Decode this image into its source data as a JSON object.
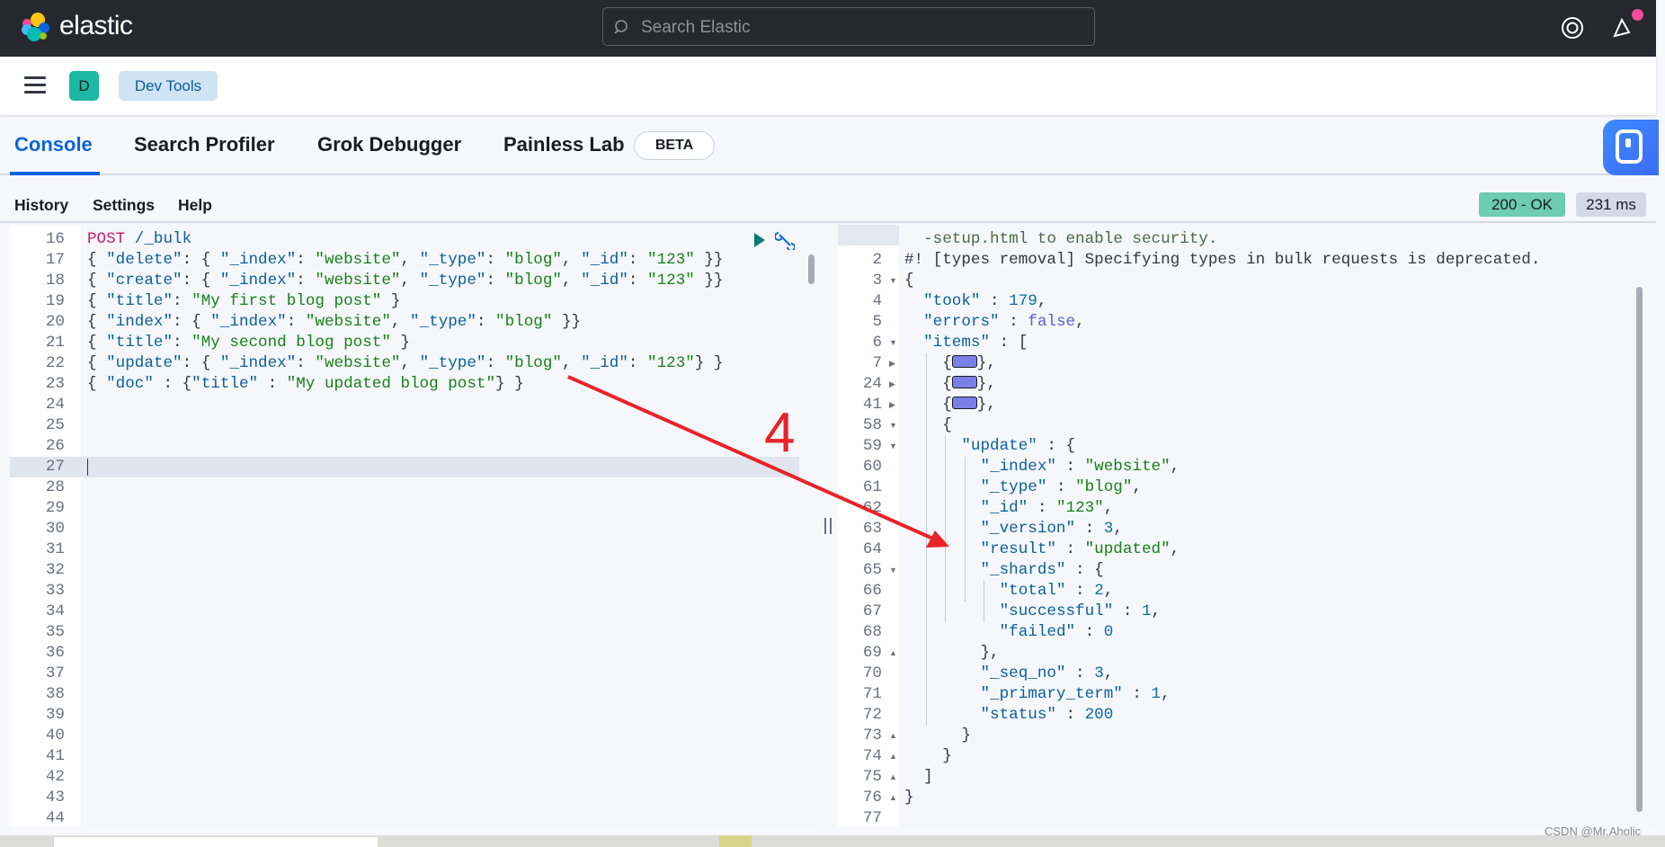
{
  "header": {
    "brand": "elastic",
    "search_placeholder": "Search Elastic"
  },
  "subheader": {
    "avatar_letter": "D",
    "breadcrumb": "Dev Tools"
  },
  "tabs": [
    {
      "label": "Console",
      "active": true
    },
    {
      "label": "Search Profiler"
    },
    {
      "label": "Grok Debugger"
    },
    {
      "label": "Painless Lab"
    }
  ],
  "beta_label": "BETA",
  "toolbar": {
    "history": "History",
    "settings": "Settings",
    "help": "Help"
  },
  "response_status": {
    "status": "200 - OK",
    "time": "231 ms",
    "status_color": "#6dccb1"
  },
  "annotation": {
    "label": "4",
    "color": "#e8232a"
  },
  "watermark": "CSDN @Mr.Aholic",
  "request_editor": {
    "active_line": 27,
    "lines": [
      {
        "n": "16",
        "t": [
          [
            "POST",
            "m"
          ],
          [
            " /_bulk",
            "k"
          ]
        ]
      },
      {
        "n": "17",
        "t": [
          [
            "{ ",
            "p"
          ],
          [
            "\"delete\"",
            "k"
          ],
          [
            ": { ",
            "p"
          ],
          [
            "\"_index\"",
            "k"
          ],
          [
            ": ",
            "p"
          ],
          [
            "\"website\"",
            "s"
          ],
          [
            ", ",
            "p"
          ],
          [
            "\"_type\"",
            "k"
          ],
          [
            ": ",
            "p"
          ],
          [
            "\"blog\"",
            "s"
          ],
          [
            ", ",
            "p"
          ],
          [
            "\"_id\"",
            "k"
          ],
          [
            ": ",
            "p"
          ],
          [
            "\"123\"",
            "s"
          ],
          [
            " }}",
            "p"
          ]
        ]
      },
      {
        "n": "18",
        "t": [
          [
            "{ ",
            "p"
          ],
          [
            "\"create\"",
            "k"
          ],
          [
            ": { ",
            "p"
          ],
          [
            "\"_index\"",
            "k"
          ],
          [
            ": ",
            "p"
          ],
          [
            "\"website\"",
            "s"
          ],
          [
            ", ",
            "p"
          ],
          [
            "\"_type\"",
            "k"
          ],
          [
            ": ",
            "p"
          ],
          [
            "\"blog\"",
            "s"
          ],
          [
            ", ",
            "p"
          ],
          [
            "\"_id\"",
            "k"
          ],
          [
            ": ",
            "p"
          ],
          [
            "\"123\"",
            "s"
          ],
          [
            " }}",
            "p"
          ]
        ]
      },
      {
        "n": "19",
        "t": [
          [
            "{ ",
            "p"
          ],
          [
            "\"title\"",
            "k"
          ],
          [
            ": ",
            "p"
          ],
          [
            "\"My first blog post\"",
            "s"
          ],
          [
            " }",
            "p"
          ]
        ]
      },
      {
        "n": "20",
        "t": [
          [
            "{ ",
            "p"
          ],
          [
            "\"index\"",
            "k"
          ],
          [
            ": { ",
            "p"
          ],
          [
            "\"_index\"",
            "k"
          ],
          [
            ": ",
            "p"
          ],
          [
            "\"website\"",
            "s"
          ],
          [
            ", ",
            "p"
          ],
          [
            "\"_type\"",
            "k"
          ],
          [
            ": ",
            "p"
          ],
          [
            "\"blog\"",
            "s"
          ],
          [
            " }}",
            "p"
          ]
        ]
      },
      {
        "n": "21",
        "t": [
          [
            "{ ",
            "p"
          ],
          [
            "\"title\"",
            "k"
          ],
          [
            ": ",
            "p"
          ],
          [
            "\"My second blog post\"",
            "s"
          ],
          [
            " }",
            "p"
          ]
        ]
      },
      {
        "n": "22",
        "t": [
          [
            "{ ",
            "p"
          ],
          [
            "\"update\"",
            "k"
          ],
          [
            ": { ",
            "p"
          ],
          [
            "\"_index\"",
            "k"
          ],
          [
            ": ",
            "p"
          ],
          [
            "\"website\"",
            "s"
          ],
          [
            ", ",
            "p"
          ],
          [
            "\"_type\"",
            "k"
          ],
          [
            ": ",
            "p"
          ],
          [
            "\"blog\"",
            "s"
          ],
          [
            ", ",
            "p"
          ],
          [
            "\"_id\"",
            "k"
          ],
          [
            ": ",
            "p"
          ],
          [
            "\"123\"",
            "s"
          ],
          [
            "} }",
            "p"
          ]
        ]
      },
      {
        "n": "23",
        "t": [
          [
            "{ ",
            "p"
          ],
          [
            "\"doc\"",
            "k"
          ],
          [
            " : {",
            "p"
          ],
          [
            "\"title\"",
            "k"
          ],
          [
            " : ",
            "p"
          ],
          [
            "\"My updated blog post\"",
            "s"
          ],
          [
            "} }",
            "p"
          ]
        ]
      },
      {
        "n": "24",
        "t": []
      },
      {
        "n": "25",
        "t": []
      },
      {
        "n": "26",
        "t": []
      },
      {
        "n": "27",
        "t": []
      },
      {
        "n": "28",
        "t": []
      },
      {
        "n": "29",
        "t": []
      },
      {
        "n": "30",
        "t": []
      },
      {
        "n": "31",
        "t": []
      },
      {
        "n": "32",
        "t": []
      },
      {
        "n": "33",
        "t": []
      },
      {
        "n": "34",
        "t": []
      },
      {
        "n": "35",
        "t": []
      },
      {
        "n": "36",
        "t": []
      },
      {
        "n": "37",
        "t": []
      },
      {
        "n": "38",
        "t": []
      },
      {
        "n": "39",
        "t": []
      },
      {
        "n": "40",
        "t": []
      },
      {
        "n": "41",
        "t": []
      },
      {
        "n": "42",
        "t": []
      },
      {
        "n": "43",
        "t": []
      },
      {
        "n": "44",
        "t": []
      }
    ]
  },
  "response_viewer": {
    "lines": [
      {
        "n": "",
        "t": [
          [
            "  -setup.html to enable security.",
            "w"
          ]
        ]
      },
      {
        "n": "2",
        "t": [
          [
            "#! [types removal] Specifying types in bulk requests is deprecated.",
            "c"
          ]
        ]
      },
      {
        "n": "3",
        "f": "down",
        "t": [
          [
            "{",
            "p"
          ]
        ]
      },
      {
        "n": "4",
        "t": [
          [
            "  ",
            "p"
          ],
          [
            "\"took\"",
            "k"
          ],
          [
            " : ",
            "p"
          ],
          [
            "179",
            "n"
          ],
          [
            ",",
            "p"
          ]
        ]
      },
      {
        "n": "5",
        "t": [
          [
            "  ",
            "p"
          ],
          [
            "\"errors\"",
            "k"
          ],
          [
            " : ",
            "p"
          ],
          [
            "false",
            "b"
          ],
          [
            ",",
            "p"
          ]
        ]
      },
      {
        "n": "6",
        "f": "down",
        "t": [
          [
            "  ",
            "p"
          ],
          [
            "\"items\"",
            "k"
          ],
          [
            " : [",
            "p"
          ]
        ]
      },
      {
        "n": "7",
        "f": "right",
        "t": [
          [
            "    {",
            "p"
          ],
          [
            "",
            "widget"
          ],
          [
            "},",
            "p"
          ]
        ]
      },
      {
        "n": "24",
        "f": "right",
        "t": [
          [
            "    {",
            "p"
          ],
          [
            "",
            "widget"
          ],
          [
            "},",
            "p"
          ]
        ]
      },
      {
        "n": "41",
        "f": "right",
        "t": [
          [
            "    {",
            "p"
          ],
          [
            "",
            "widget"
          ],
          [
            "},",
            "p"
          ]
        ]
      },
      {
        "n": "58",
        "f": "down",
        "t": [
          [
            "    {",
            "p"
          ]
        ]
      },
      {
        "n": "59",
        "f": "down",
        "t": [
          [
            "      ",
            "p"
          ],
          [
            "\"update\"",
            "k"
          ],
          [
            " : {",
            "p"
          ]
        ]
      },
      {
        "n": "60",
        "t": [
          [
            "        ",
            "p"
          ],
          [
            "\"_index\"",
            "k"
          ],
          [
            " : ",
            "p"
          ],
          [
            "\"website\"",
            "s"
          ],
          [
            ",",
            "p"
          ]
        ]
      },
      {
        "n": "61",
        "t": [
          [
            "        ",
            "p"
          ],
          [
            "\"_type\"",
            "k"
          ],
          [
            " : ",
            "p"
          ],
          [
            "\"blog\"",
            "s"
          ],
          [
            ",",
            "p"
          ]
        ]
      },
      {
        "n": "62",
        "t": [
          [
            "        ",
            "p"
          ],
          [
            "\"_id\"",
            "k"
          ],
          [
            " : ",
            "p"
          ],
          [
            "\"123\"",
            "s"
          ],
          [
            ",",
            "p"
          ]
        ]
      },
      {
        "n": "63",
        "t": [
          [
            "        ",
            "p"
          ],
          [
            "\"_version\"",
            "k"
          ],
          [
            " : ",
            "p"
          ],
          [
            "3",
            "n"
          ],
          [
            ",",
            "p"
          ]
        ]
      },
      {
        "n": "64",
        "t": [
          [
            "        ",
            "p"
          ],
          [
            "\"result\"",
            "k"
          ],
          [
            " : ",
            "p"
          ],
          [
            "\"updated\"",
            "s"
          ],
          [
            ",",
            "p"
          ]
        ]
      },
      {
        "n": "65",
        "f": "down",
        "t": [
          [
            "        ",
            "p"
          ],
          [
            "\"_shards\"",
            "k"
          ],
          [
            " : {",
            "p"
          ]
        ]
      },
      {
        "n": "66",
        "t": [
          [
            "          ",
            "p"
          ],
          [
            "\"total\"",
            "k"
          ],
          [
            " : ",
            "p"
          ],
          [
            "2",
            "n"
          ],
          [
            ",",
            "p"
          ]
        ]
      },
      {
        "n": "67",
        "t": [
          [
            "          ",
            "p"
          ],
          [
            "\"successful\"",
            "k"
          ],
          [
            " : ",
            "p"
          ],
          [
            "1",
            "n"
          ],
          [
            ",",
            "p"
          ]
        ]
      },
      {
        "n": "68",
        "t": [
          [
            "          ",
            "p"
          ],
          [
            "\"failed\"",
            "k"
          ],
          [
            " : ",
            "p"
          ],
          [
            "0",
            "n"
          ]
        ]
      },
      {
        "n": "69",
        "f": "up",
        "t": [
          [
            "        },",
            "p"
          ]
        ]
      },
      {
        "n": "70",
        "t": [
          [
            "        ",
            "p"
          ],
          [
            "\"_seq_no\"",
            "k"
          ],
          [
            " : ",
            "p"
          ],
          [
            "3",
            "n"
          ],
          [
            ",",
            "p"
          ]
        ]
      },
      {
        "n": "71",
        "t": [
          [
            "        ",
            "p"
          ],
          [
            "\"_primary_term\"",
            "k"
          ],
          [
            " : ",
            "p"
          ],
          [
            "1",
            "n"
          ],
          [
            ",",
            "p"
          ]
        ]
      },
      {
        "n": "72",
        "t": [
          [
            "        ",
            "p"
          ],
          [
            "\"status\"",
            "k"
          ],
          [
            " : ",
            "p"
          ],
          [
            "200",
            "n"
          ]
        ]
      },
      {
        "n": "73",
        "f": "up",
        "t": [
          [
            "      }",
            "p"
          ]
        ]
      },
      {
        "n": "74",
        "f": "up",
        "t": [
          [
            "    }",
            "p"
          ]
        ]
      },
      {
        "n": "75",
        "f": "up",
        "t": [
          [
            "  ]",
            "p"
          ]
        ]
      },
      {
        "n": "76",
        "f": "up",
        "t": [
          [
            "}",
            "p"
          ]
        ]
      },
      {
        "n": "77",
        "t": []
      }
    ]
  }
}
